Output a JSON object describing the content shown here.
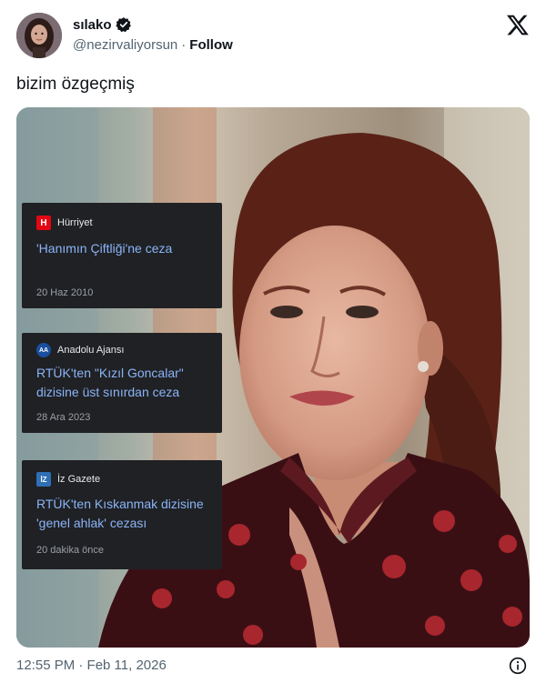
{
  "author": {
    "display_name": "sılako",
    "handle": "@nezirvaliyorsun",
    "separator": "·",
    "follow_label": "Follow",
    "verified": true
  },
  "tweet": {
    "text": "bizim özgeçmiş"
  },
  "news_cards": [
    {
      "source": "Hürriyet",
      "icon_text": "H",
      "icon_color": "#e30613",
      "title": "'Hanımın Çiftliği'ne ceza",
      "date": "20 Haz 2010"
    },
    {
      "source": "Anadolu Ajansı",
      "icon_text": "AA",
      "icon_color": "#1a4fa0",
      "title": "RTÜK'ten \"Kızıl Goncalar\" dizisine üst sınırdan ceza",
      "date": "28 Ara 2023"
    },
    {
      "source": "İz Gazete",
      "icon_text": "İZ",
      "icon_color": "#2e6fb5",
      "title": "RTÜK'ten Kıskanmak dizisine 'genel ahlak' cezası",
      "date": "20 dakika önce"
    }
  ],
  "footer": {
    "timestamp": "12:55 PM · Feb 11, 2026"
  },
  "icons": {
    "logo": "x-logo-icon",
    "verified": "verified-badge-icon",
    "info": "info-icon"
  }
}
